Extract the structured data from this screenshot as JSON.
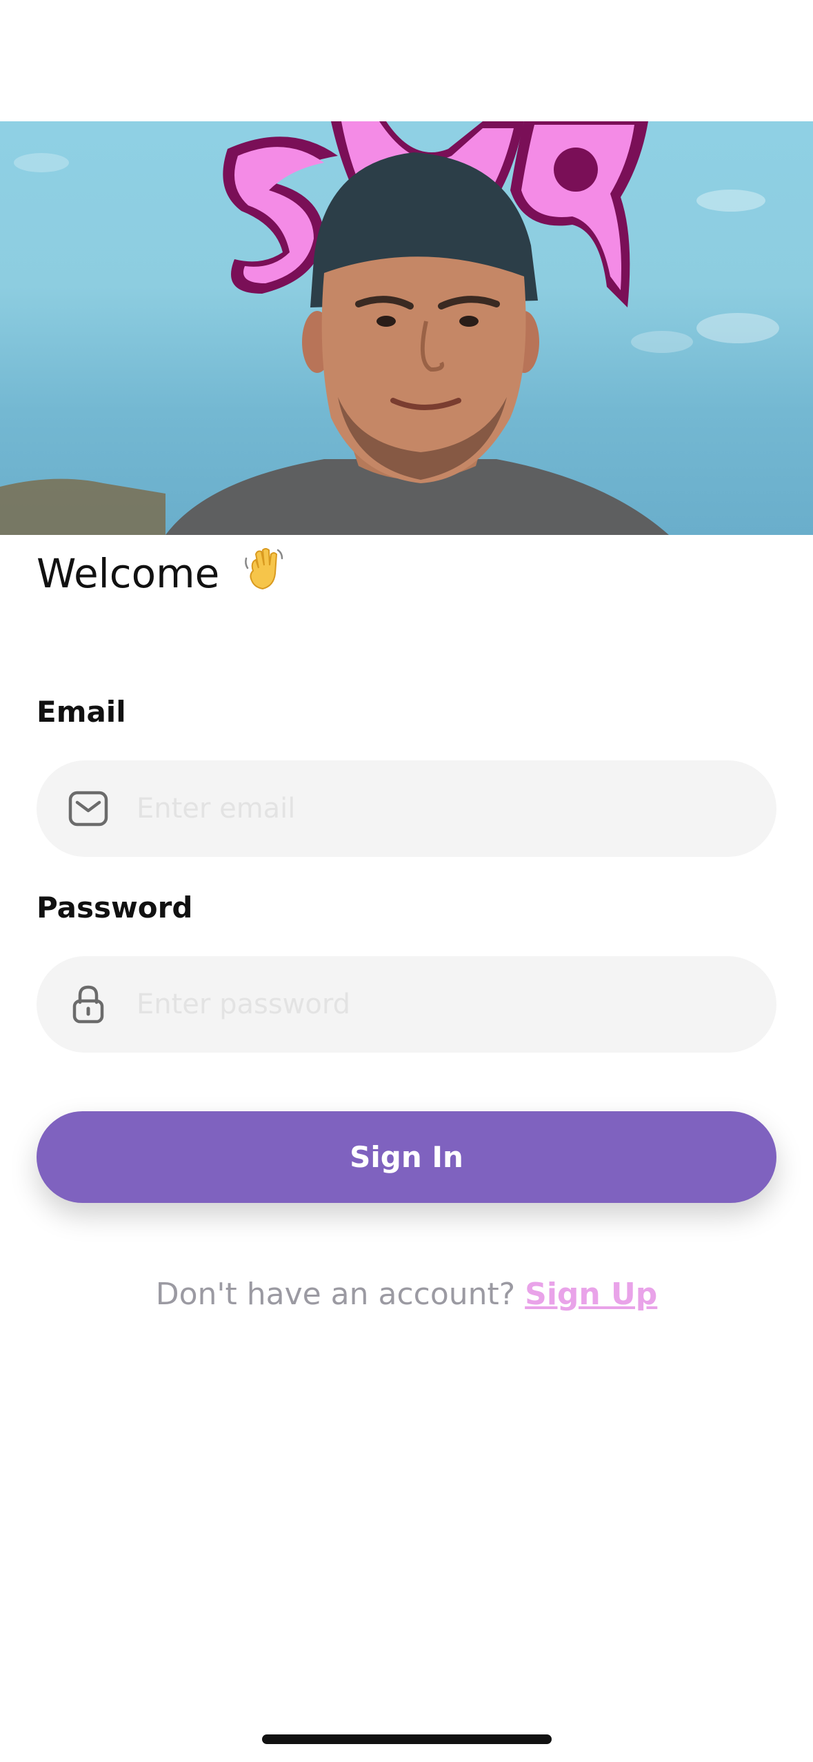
{
  "welcome": {
    "title": "Welcome",
    "emoji": "👋"
  },
  "form": {
    "email_label": "Email",
    "email_placeholder": "Enter email",
    "email_icon": "mail-icon",
    "password_label": "Password",
    "password_placeholder": "Enter password",
    "password_icon": "lock-icon",
    "submit_label": "Sign In"
  },
  "signup": {
    "prompt": "Don't have an account? ",
    "link_label": "Sign Up"
  },
  "colors": {
    "primary": "#7f62bf",
    "link": "#e9a3e9",
    "field_bg": "#f4f4f4",
    "logo_pink": "#f48be6",
    "logo_outline": "#7a0f57"
  }
}
